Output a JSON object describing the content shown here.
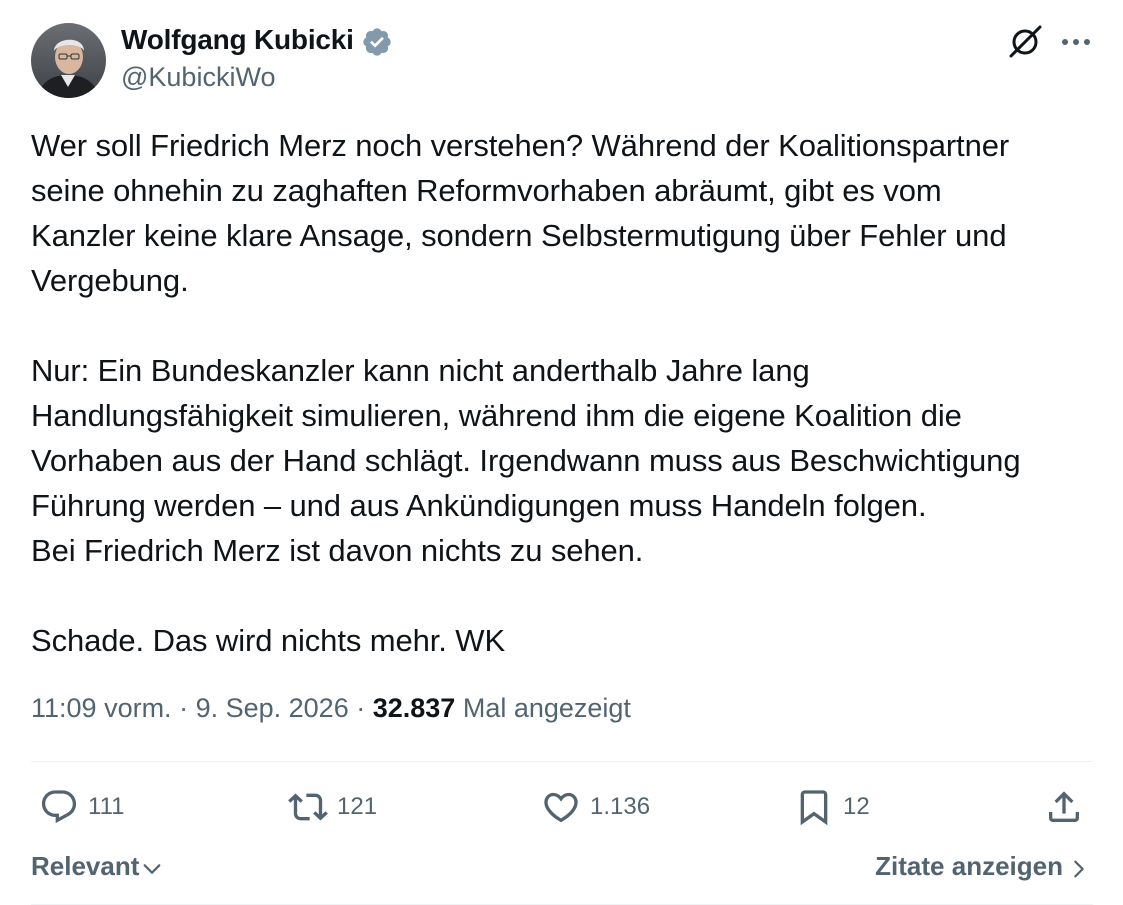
{
  "author": {
    "name": "Wolfgang Kubicki",
    "handle": "@KubickiWo",
    "verified": true
  },
  "icons": {
    "verified": "verified-badge-icon",
    "grok": "grok-icon",
    "more": "more-options-icon",
    "reply": "reply-icon",
    "retweet": "retweet-icon",
    "like": "heart-icon",
    "bookmark": "bookmark-icon",
    "share": "share-icon"
  },
  "tweet": {
    "paragraphs": [
      "Wer soll Friedrich Merz noch verstehen? Während der Koalitionspartner\nseine ohnehin zu zaghaften Reformvorhaben abräumt, gibt es vom\nKanzler keine klare Ansage, sondern Selbstermutigung über Fehler und\nVergebung.",
      "Nur: Ein Bundeskanzler kann nicht anderthalb Jahre lang\nHandlungsfähigkeit simulieren, während ihm die eigene Koalition die\nVorhaben aus der Hand schlägt. Irgendwann muss aus Beschwichtigung\nFührung werden – und aus Ankündigungen muss Handeln folgen.\nBei Friedrich Merz ist davon nichts zu sehen.",
      "Schade. Das wird nichts mehr. WK"
    ]
  },
  "meta": {
    "time": "11:09 vorm.",
    "separator": " · ",
    "date": "9. Sep. 2026",
    "views_count": "32.837",
    "views_label": "Mal angezeigt"
  },
  "actions": {
    "replies": "111",
    "retweets": "121",
    "likes": "1.136",
    "bookmarks": "12"
  },
  "footer": {
    "sort_label": "Relevant",
    "quotes_label": "Zitate anzeigen"
  },
  "colors": {
    "text": "#0f1419",
    "secondary": "#536471",
    "verified": "#829aab",
    "divider": "#eff3f4"
  }
}
